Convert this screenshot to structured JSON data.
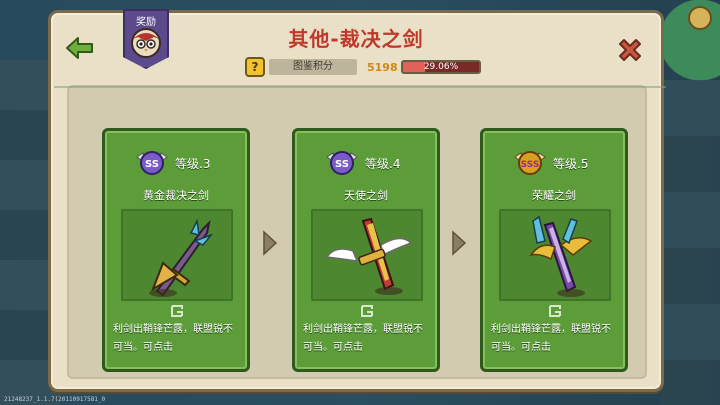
{
  "header": {
    "title": "其他-裁决之剑",
    "avatar_label": "奖励"
  },
  "score": {
    "icon": "question-icon",
    "label": "图鉴积分",
    "value": "5198",
    "progress_text": "29.06%",
    "progress_fraction": 0.2906
  },
  "cards": [
    {
      "badge": "SS",
      "level": "等级.3",
      "name": "黄金裁决之剑",
      "desc": "利剑出鞘锋芒露，联盟锐不可当。可点击",
      "badge_color": "#7a5ac8"
    },
    {
      "badge": "SS",
      "level": "等级.4",
      "name": "天使之剑",
      "desc": "利剑出鞘锋芒露，联盟锐不可当。可点击",
      "badge_color": "#7a5ac8"
    },
    {
      "badge": "SSS",
      "level": "等级.5",
      "name": "荣耀之剑",
      "desc": "利剑出鞘锋芒露，联盟锐不可当。可点击",
      "badge_color": "#d9a020"
    }
  ],
  "build_text": "21248237_1.1.7(20110917581_0",
  "colors": {
    "title": "#c0392b",
    "card_green": "#5c9c39",
    "panel": "#e9e0c7"
  }
}
